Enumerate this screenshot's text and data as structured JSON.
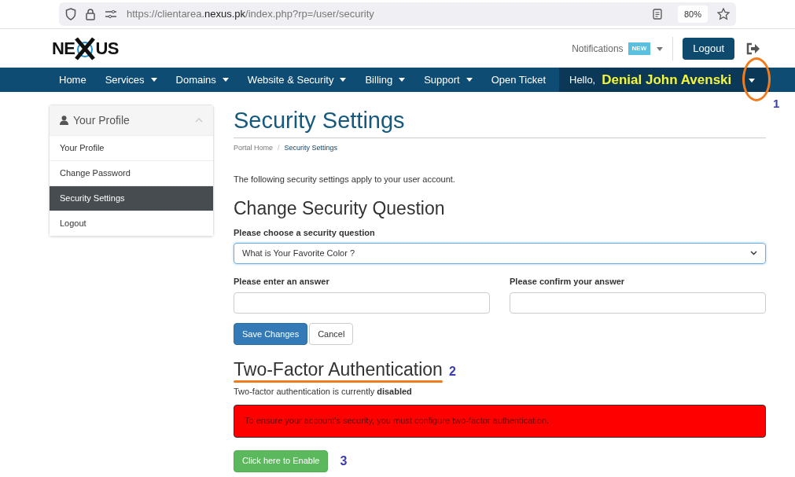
{
  "browser": {
    "url_scheme": "https://",
    "url_host": "clientarea.",
    "url_domain": "nexus.pk",
    "url_path": "/index.php?rp=/user/security",
    "zoom": "80%"
  },
  "logo": {
    "left": "NE",
    "right": "US"
  },
  "header": {
    "notifications": "Notifications",
    "badge": "NEW",
    "logout": "Logout"
  },
  "nav": [
    {
      "label": "Home",
      "dropdown": false
    },
    {
      "label": "Services",
      "dropdown": true
    },
    {
      "label": "Domains",
      "dropdown": true
    },
    {
      "label": "Website & Security",
      "dropdown": true
    },
    {
      "label": "Billing",
      "dropdown": true
    },
    {
      "label": "Support",
      "dropdown": true
    },
    {
      "label": "Open Ticket",
      "dropdown": false
    }
  ],
  "greeting": {
    "hello": "Hello,",
    "name": "Denial John Avenski"
  },
  "sidebar": {
    "title": "Your Profile",
    "expanded": true,
    "items": [
      {
        "label": "Your Profile",
        "selected": false
      },
      {
        "label": "Change Password",
        "selected": false
      },
      {
        "label": "Security Settings",
        "selected": true
      },
      {
        "label": "Logout",
        "selected": false
      }
    ]
  },
  "page": {
    "title": "Security Settings",
    "breadcrumb_separator": "/",
    "breadcrumb": [
      {
        "label": "Portal Home",
        "selected": false
      },
      {
        "label": "Security Settings",
        "selected": true
      }
    ],
    "intro": "The following security settings apply to your user account."
  },
  "question": {
    "heading": "Change Security Question",
    "select_label": "Please choose a security question",
    "select_value": "What is Your Favorite Color ?",
    "answer_label": "Please enter an answer",
    "confirm_label": "Please confirm your answer",
    "save": "Save Changes",
    "cancel": "Cancel"
  },
  "twofactor": {
    "heading": "Two-Factor Authentication",
    "status": "Two-factor authentication is currently **disabled**",
    "alert": "To ensure your account's security, you must configure two-factor authentication.",
    "enable": "Click here to Enable"
  },
  "annotations": [
    "1",
    "2",
    "3"
  ]
}
